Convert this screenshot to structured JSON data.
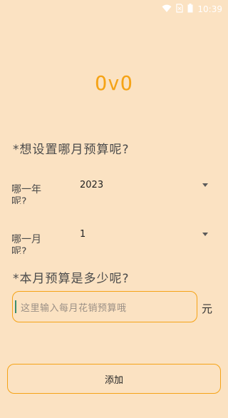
{
  "status_bar": {
    "time": "10:39",
    "icons": [
      "wifi-icon",
      "no-sim-icon",
      "battery-icon"
    ]
  },
  "app": {
    "logo_text": "OvO"
  },
  "form": {
    "question_month": "*想设置哪月预算呢?",
    "year_label": "哪一年呢?",
    "year_value": "2023",
    "month_label": "哪一月呢?",
    "month_value": "1",
    "question_budget": "*本月预算是多少呢?",
    "budget_placeholder": "这里输入每月花销预算哦",
    "unit": "元",
    "add_label": "添加"
  },
  "colors": {
    "background": "#FBE2C2",
    "accent": "#F5A316",
    "caret": "#3C8D6E"
  }
}
